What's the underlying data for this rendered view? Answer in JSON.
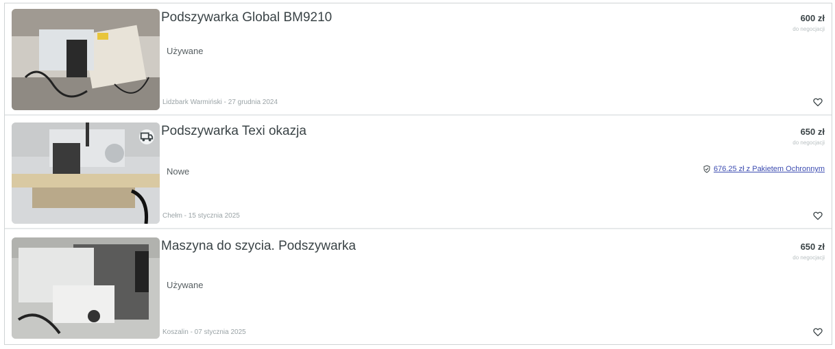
{
  "listings": [
    {
      "title": "Podszywarka Global BM9210",
      "condition": "Używane",
      "location_date": "Lidzbark Warmiński - 27 grudnia 2024",
      "price": "600 zł",
      "negotiable": "do negocjacji",
      "protection": ""
    },
    {
      "title": "Podszywarka Texi okazja",
      "condition": "Nowe",
      "location_date": "Chełm - 15 stycznia 2025",
      "price": "650 zł",
      "negotiable": "do negocjacji",
      "protection": "676.25 zł z Pakietem Ochronnym"
    },
    {
      "title": "Maszyna do szycia. Podszywarka",
      "condition": "Używane",
      "location_date": "Koszalin - 07 stycznia 2025",
      "price": "650 zł",
      "negotiable": "do negocjacji",
      "protection": ""
    }
  ],
  "icons": {
    "favorite": "heart-icon",
    "delivery_badge": "truck-badge-icon",
    "protection": "shield-icon"
  },
  "colors": {
    "text": "#3a4346",
    "link": "#3b4bb0",
    "muted": "#9aa3a6"
  }
}
